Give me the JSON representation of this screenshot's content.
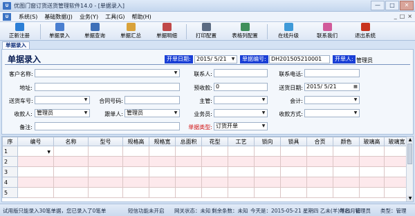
{
  "window": {
    "title": "优图门窗订货送货管理软件14.0 - [单据录入]",
    "app_icon": "U",
    "controls": [
      "—",
      "□",
      "✕"
    ]
  },
  "menubar": {
    "icon": "U",
    "items": [
      "系统(S)",
      "基础数据(J)",
      "业务(Y)",
      "工具(G)",
      "帮助(H)"
    ],
    "right": [
      "_",
      "□",
      "×"
    ]
  },
  "toolbar": {
    "buttons": [
      {
        "label": "正新注册",
        "icon": "register-icon",
        "color": "#2c7fd6"
      },
      {
        "label": "单据录入",
        "icon": "document-entry-icon",
        "color": "#4a7fd0"
      },
      {
        "label": "单据查询",
        "icon": "document-search-icon",
        "color": "#3d6fb8"
      },
      {
        "label": "单据汇总",
        "icon": "document-summary-icon",
        "color": "#d9a23a"
      },
      {
        "label": "单据明细",
        "icon": "document-detail-icon",
        "color": "#c04848"
      },
      {
        "label": "打印配置",
        "icon": "print-icon",
        "color": "#5b6b82"
      },
      {
        "label": "表格列配置",
        "icon": "table-config-icon",
        "color": "#3f8f5a"
      },
      {
        "label": "在线升级",
        "icon": "upgrade-icon",
        "color": "#3f9ad8"
      },
      {
        "label": "联系我们",
        "icon": "contact-icon",
        "color": "#d15a9a"
      },
      {
        "label": "退出系统",
        "icon": "exit-icon",
        "color": "#c8331e"
      }
    ]
  },
  "tab": {
    "label": "单据录入"
  },
  "form": {
    "title": "单据录入",
    "open_date_label": "开单日期:",
    "open_date_value": "2015/ 5/21",
    "doc_no_label": "单据编号:",
    "doc_no_value": "DH201505210001",
    "operator_label": "开单人:",
    "operator_value": "管理员",
    "customer_label": "客户名称:",
    "customer_value": "",
    "contact_label": "联系人:",
    "contact_value": "",
    "phone_label": "联系电话:",
    "phone_value": "",
    "address_label": "地址:",
    "address_value": "",
    "prepay_label": "预收款:",
    "prepay_value": "0",
    "delivery_date_label": "送货日期:",
    "delivery_date_value": "2015/ 5/21",
    "car_label": "送货车号:",
    "car_value": "",
    "contract_label": "合同号码:",
    "contract_value": "",
    "manager_label": "主管:",
    "manager_value": "",
    "accountant_label": "会计:",
    "accountant_value": "",
    "payee_label": "收款人:",
    "payee_value": "管理员",
    "follower_label": "跟单人:",
    "follower_value": "管理员",
    "salesman_label": "业务员:",
    "salesman_value": "",
    "pay_method_label": "收款方式:",
    "pay_method_value": "",
    "remark_label": "备注:",
    "remark_value": "",
    "doc_type_label": "单据类型:",
    "doc_type_value": "订货开单"
  },
  "grid": {
    "columns": [
      "序",
      "编号",
      "名称",
      "型号",
      "规格高",
      "规格宽",
      "总面积",
      "花型",
      "工艺",
      "锁向",
      "锁具",
      "合页",
      "颜色",
      "玻璃高",
      "玻璃宽"
    ],
    "rows": [
      "1",
      "2",
      "3",
      "4",
      "5"
    ]
  },
  "status": {
    "trial": "试用版只能录入30笔单据，您已录入了0笔单",
    "sms": "短信功能未开启",
    "network": "网关状态：未知",
    "remaining": "剩余条数：未知",
    "today": "今天是：2015-05-21 星期四 乙未(羊)年四月初",
    "user": "姓名：管理员",
    "type": "类型：管理"
  }
}
